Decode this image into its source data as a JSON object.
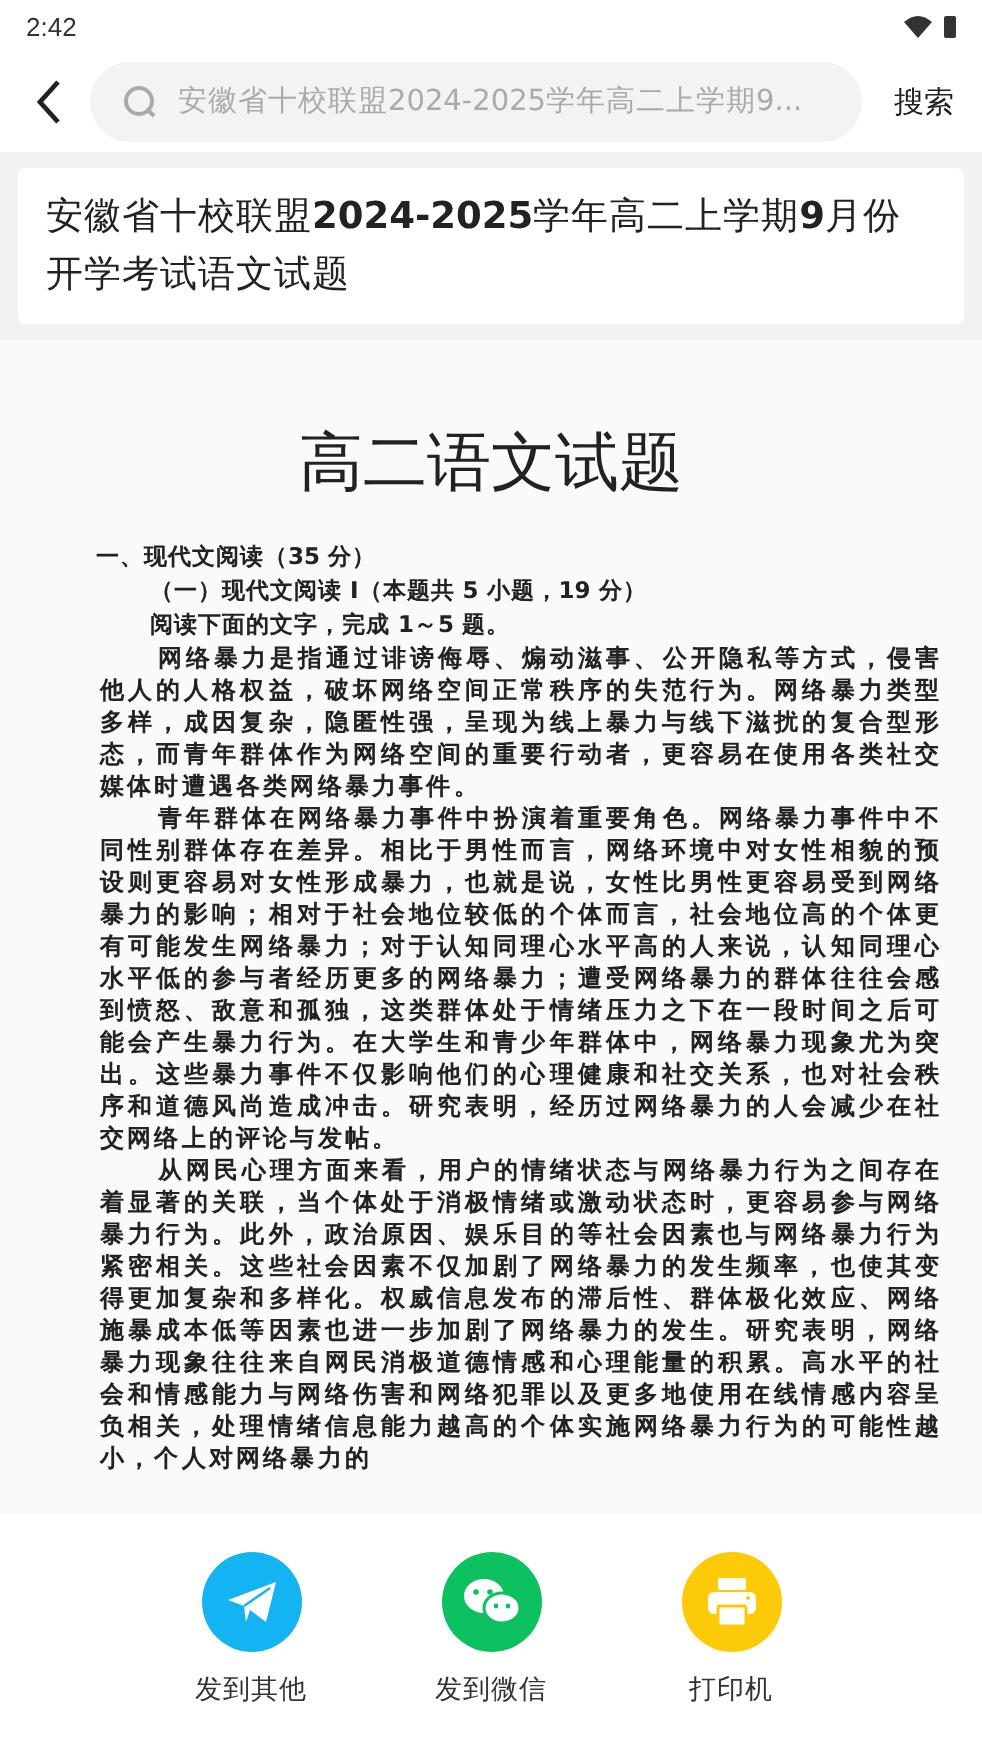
{
  "status_bar": {
    "time": "2:42"
  },
  "search": {
    "placeholder": "安徽省十校联盟2024-2025学年高二上学期9...",
    "button": "搜索"
  },
  "title": "安徽省十校联盟**2024-2025**学年高二上学期**9**月份开学考试语文试题",
  "document": {
    "heading": "高二语文试题",
    "section": "一、现代文阅读（35 分）",
    "subsection": "（一）现代文阅读 I（本题共 5 小题，19 分）",
    "instruction": "阅读下面的文字，完成 1～5 题。",
    "paragraphs": [
      "网络暴力是指通过诽谤侮辱、煽动滋事、公开隐私等方式，侵害他人的人格权益，破坏网络空间正常秩序的失范行为。网络暴力类型多样，成因复杂，隐匿性强，呈现为线上暴力与线下滋扰的复合型形态，而青年群体作为网络空间的重要行动者，更容易在使用各类社交媒体时遭遇各类网络暴力事件。",
      "青年群体在网络暴力事件中扮演着重要角色。网络暴力事件中不同性别群体存在差异。相比于男性而言，网络环境中对女性相貌的预设则更容易对女性形成暴力，也就是说，女性比男性更容易受到网络暴力的影响；相对于社会地位较低的个体而言，社会地位高的个体更有可能发生网络暴力；对于认知同理心水平高的人来说，认知同理心水平低的参与者经历更多的网络暴力；遭受网络暴力的群体往往会感到愤怒、敌意和孤独，这类群体处于情绪压力之下在一段时间之后可能会产生暴力行为。在大学生和青少年群体中，网络暴力现象尤为突出。这些暴力事件不仅影响他们的心理健康和社交关系，也对社会秩序和道德风尚造成冲击。研究表明，经历过网络暴力的人会减少在社交网络上的评论与发帖。",
      "从网民心理方面来看，用户的情绪状态与网络暴力行为之间存在着显著的关联，当个体处于消极情绪或激动状态时，更容易参与网络暴力行为。此外，政治原因、娱乐目的等社会因素也与网络暴力行为紧密相关。这些社会因素不仅加剧了网络暴力的发生频率，也使其变得更加复杂和多样化。权威信息发布的滞后性、群体极化效应、网络施暴成本低等因素也进一步加剧了网络暴力的发生。研究表明，网络暴力现象往往来自网民消极道德情感和心理能量的积累。高水平的社会和情感能力与网络伤害和网络犯罪以及更多地使用在线情感内容呈负相关，处理情绪信息能力越高的个体实施网络暴力行为的可能性越小，个人对网络暴力的"
    ]
  },
  "share_actions": [
    {
      "kind": "other",
      "label": "发到其他"
    },
    {
      "kind": "wechat",
      "label": "发到微信"
    },
    {
      "kind": "printer",
      "label": "打印机"
    }
  ]
}
